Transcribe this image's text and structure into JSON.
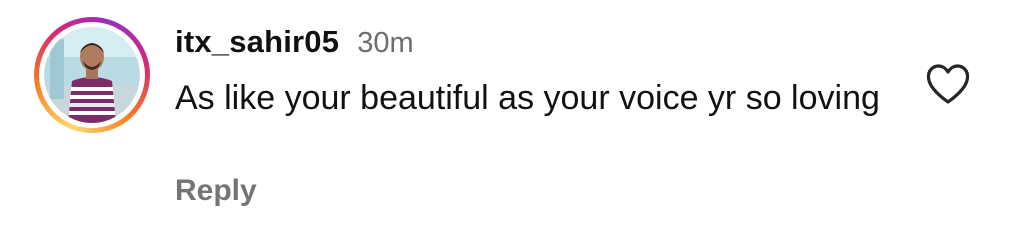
{
  "comment": {
    "username": "itx_sahir05",
    "timestamp": "30m",
    "text": "As like your beautiful as your voice yr so loving",
    "reply_label": "Reply",
    "story_ring_colors": [
      "#feda75",
      "#fa7e1e",
      "#d62976",
      "#962fbf"
    ],
    "like_icon": "heart-outline-icon",
    "avatar_icon": "profile-photo"
  }
}
